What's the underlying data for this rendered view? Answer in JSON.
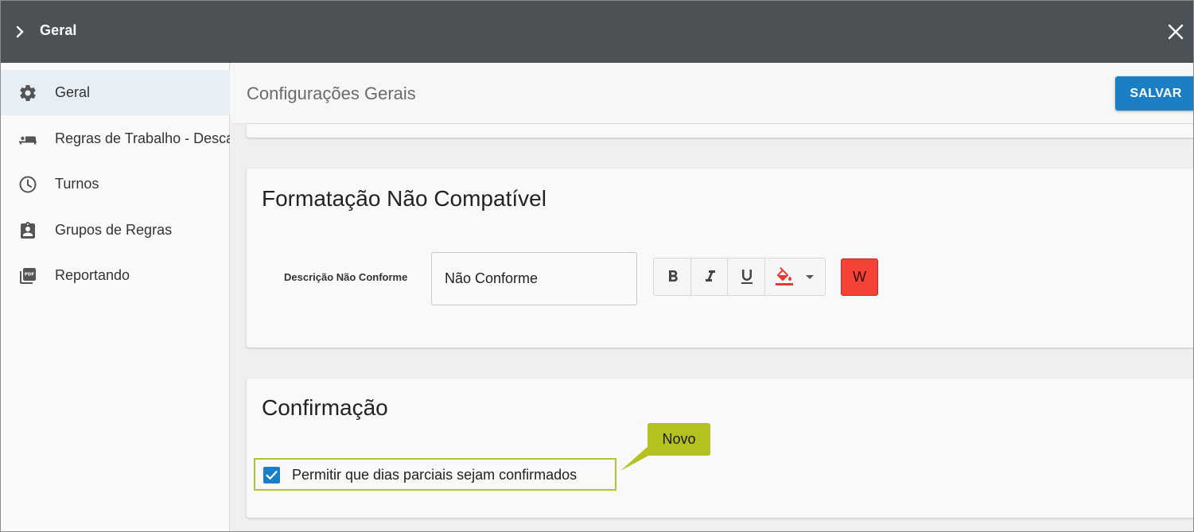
{
  "window": {
    "title": "Geral"
  },
  "sidebar": {
    "items": [
      {
        "label": "Geral",
        "icon": "gear-icon",
        "active": true
      },
      {
        "label": "Regras de Trabalho - Descanso",
        "icon": "bed-icon"
      },
      {
        "label": "Turnos",
        "icon": "clock-icon"
      },
      {
        "label": "Grupos de Regras",
        "icon": "clipboard-person-icon"
      },
      {
        "label": "Reportando",
        "icon": "pdf-icon"
      }
    ]
  },
  "header": {
    "title": "Configurações Gerais",
    "save_label": "SALVAR"
  },
  "formatting": {
    "title": "Formatação Não Compatível",
    "field_label": "Descrição Não Conforme",
    "field_value": "Não Conforme",
    "toolbar": [
      "bold-icon",
      "italic-icon",
      "underline-icon",
      "fill-color-icon"
    ],
    "preview_label": "W",
    "preview_color": "#f44336"
  },
  "confirmation": {
    "title": "Confirmação",
    "checkbox_label": "Permitir que dias parciais sejam confirmados",
    "checked": true,
    "callout": "Novo"
  },
  "colors": {
    "topbar": "#4c5156",
    "accent": "#1a7fc4",
    "highlight": "#b5c021"
  }
}
